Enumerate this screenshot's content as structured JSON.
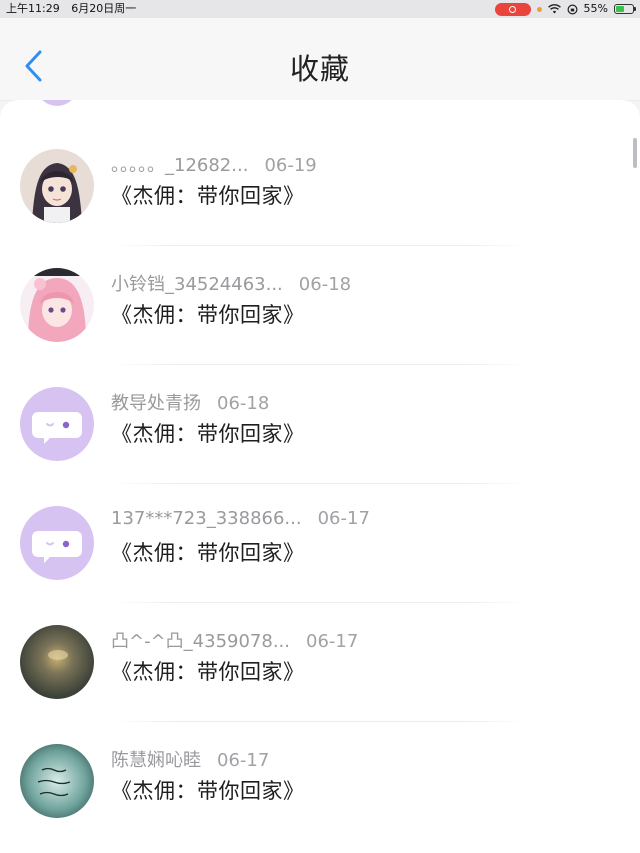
{
  "status_bar": {
    "time": "上午11:29",
    "date": "6月20日周一",
    "battery": "55%",
    "battery_level": 0.55
  },
  "nav": {
    "title": "收藏"
  },
  "items": [
    {
      "name": "。。。。。_12682...",
      "date": "06-19",
      "message": "《杰佣：带你回家》",
      "avatar": "anime-girl-dark-hair"
    },
    {
      "name": "小铃铛_34524463...",
      "date": "06-18",
      "message": "《杰佣：带你回家》",
      "avatar": "anime-girl-pink-hair"
    },
    {
      "name": "教导处青扬",
      "date": "06-18",
      "message": "《杰佣：带你回家》",
      "avatar": "default-chat-bubble"
    },
    {
      "name": "137***723_338866...",
      "date": "06-17",
      "message": "《杰佣：带你回家》",
      "avatar": "default-chat-bubble"
    },
    {
      "name": "凸^-^凸_4359078...",
      "date": "06-17",
      "message": "《杰佣：带你回家》",
      "avatar": "dark-cloudy-photo"
    },
    {
      "name": "陈慧娴吣睦",
      "date": "06-17",
      "message": "《杰佣：带你回家》",
      "avatar": "teal-handwriting-photo"
    }
  ],
  "colors": {
    "accent": "#2f8ff0",
    "default_avatar": "#d7c3f2"
  }
}
